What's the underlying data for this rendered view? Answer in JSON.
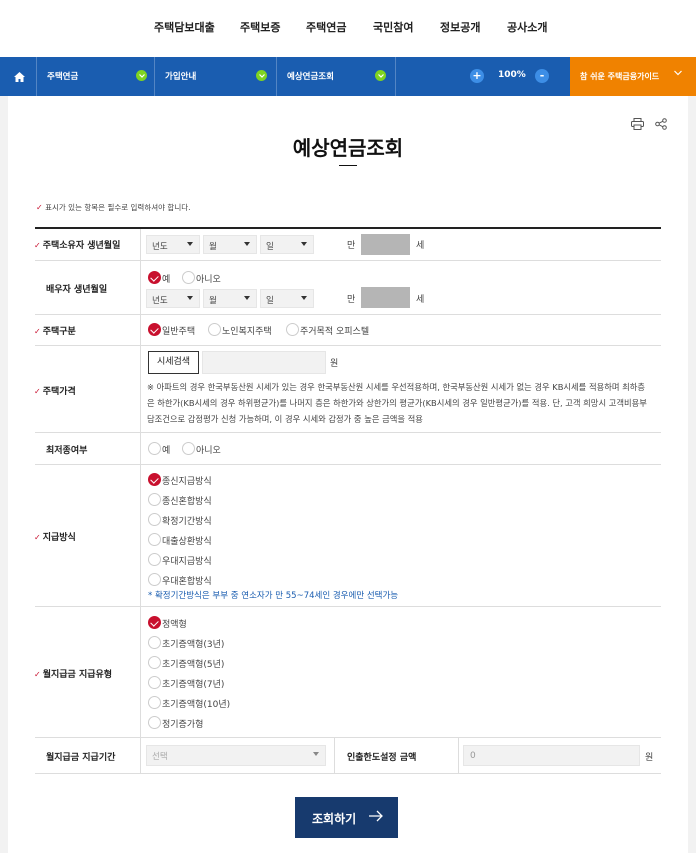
{
  "top_menu": [
    "주택담보대출",
    "주택보증",
    "주택연금",
    "국민참여",
    "정보공개",
    "공사소개"
  ],
  "breadcrumb": {
    "level1": "주택연금",
    "level2": "가입안내",
    "level3": "예상연금조회"
  },
  "zoom": {
    "minus": "+",
    "value": "100%",
    "plus": "-"
  },
  "guide_label": "참 쉬운 주택금융가이드",
  "page_title": "예상연금조회",
  "required_note": "표시가 있는 항목은 필수로 입력하셔야 합니다.",
  "form": {
    "owner_birth": {
      "label": "주택소유자 생년월일",
      "year": "년도",
      "month": "월",
      "day": "일",
      "age_prefix": "만",
      "age_suffix": "세"
    },
    "spouse_birth": {
      "label": "배우자 생년월일",
      "yes": "예",
      "no": "아니오",
      "year": "년도",
      "month": "월",
      "day": "일",
      "age_prefix": "만",
      "age_suffix": "세"
    },
    "house_type": {
      "label": "주택구분",
      "options": [
        "일반주택",
        "노인복지주택",
        "주거목적 오피스텔"
      ]
    },
    "house_price": {
      "label": "주택가격",
      "search_button": "시세검색",
      "unit": "원",
      "description": "※ 아파트의 경우 한국부동산원 시세가 있는 경우 한국부동산원 시세를 우선적용하며, 한국부동산원 시세가 없는 경우 KB시세를 적용하며 최하층은 하한가(KB시세의 경우 하위평균가)를 나머지 층은 하한가와 상한가의 평균가(KB시세의 경우 일반평균가)를 적용. 단, 고객 희망시 고객비용부담조건으로 감정평가 신청 가능하며, 이 경우 시세와 감정가 중 높은 금액을 적용"
    },
    "min_guarantee": {
      "label": "최저종여부",
      "yes": "예",
      "no": "아니오"
    },
    "payment_method": {
      "label": "지급방식",
      "options": [
        "종신지급방식",
        "종신혼합방식",
        "확정기간방식",
        "대출상환방식",
        "우대지급방식",
        "우대혼합방식"
      ],
      "note": "* 확정기간방식은 부부 중 연소자가 만 55~74세인 경우에만 선택가능"
    },
    "monthly_type": {
      "label": "월지급금 지급유형",
      "options": [
        "정액형",
        "초기증액형(3년)",
        "초기증액형(5년)",
        "초기증액형(7년)",
        "초기증액형(10년)",
        "정기증가형"
      ]
    },
    "monthly_period": {
      "label": "월지급금 지급기간",
      "placeholder": "선택",
      "limit_label": "인출한도설정 금액",
      "limit_value": "0",
      "unit": "원"
    }
  },
  "submit_label": "조회하기",
  "colors": {
    "nav_blue": "#1a5db0",
    "guide_orange": "#f08200",
    "check_red": "#c8102e",
    "submit_navy": "#173a6e"
  }
}
